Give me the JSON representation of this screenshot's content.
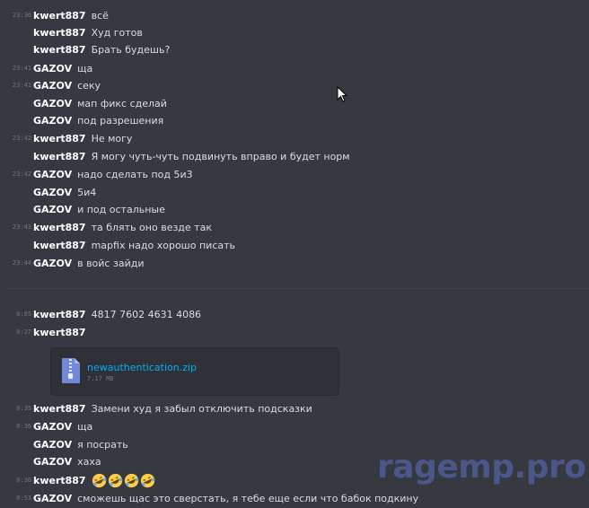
{
  "messages_top": [
    {
      "time": "23:36",
      "author": "kwert887",
      "text": "всё"
    },
    {
      "time": "",
      "author": "kwert887",
      "text": "Худ готов"
    },
    {
      "time": "",
      "author": "kwert887",
      "text": "Брать будешь?"
    },
    {
      "time": "23:41",
      "author": "GAZOV",
      "text": "ща"
    },
    {
      "time": "23:41",
      "author": "GAZOV",
      "text": "секу"
    },
    {
      "time": "",
      "author": "GAZOV",
      "text": "мап фикс сделай"
    },
    {
      "time": "",
      "author": "GAZOV",
      "text": "под разрешения"
    },
    {
      "time": "23:42",
      "author": "kwert887",
      "text": "Не могу"
    },
    {
      "time": "",
      "author": "kwert887",
      "text": "Я могу чуть-чуть подвинуть вправо и будет норм"
    },
    {
      "time": "23:42",
      "author": "GAZOV",
      "text": "надо сделать под 5и3"
    },
    {
      "time": "",
      "author": "GAZOV",
      "text": "5и4"
    },
    {
      "time": "",
      "author": "GAZOV",
      "text": "и под остальные"
    },
    {
      "time": "23:43",
      "author": "kwert887",
      "text": "та блять оно везде так"
    },
    {
      "time": "",
      "author": "kwert887",
      "text": "mapfix надо хорошо писать"
    },
    {
      "time": "23:44",
      "author": "GAZOV",
      "text": "в войс зайди"
    }
  ],
  "messages_bottom": [
    {
      "time": "0:05",
      "author": "kwert887",
      "text": "4817 7602 4631 4086"
    },
    {
      "time": "0:27",
      "author": "kwert887",
      "text": ""
    },
    {
      "time": "0:35",
      "author": "kwert887",
      "text": "Замени худ я забыл отключить подсказки"
    },
    {
      "time": "0:36",
      "author": "GAZOV",
      "text": "ща"
    },
    {
      "time": "",
      "author": "GAZOV",
      "text": "я посрать"
    },
    {
      "time": "",
      "author": "GAZOV",
      "text": "хаха"
    },
    {
      "time": "0:36",
      "author": "kwert887",
      "text": ""
    },
    {
      "time": "0:53",
      "author": "GAZOV",
      "text": "сможешь щас это сверстать, я тебе еще если что бабок подкину"
    }
  ],
  "attachment": {
    "file_name": "newauthentication.zip",
    "file_size": "7.17 MB",
    "icon": "zip-file-icon"
  },
  "reaction_emojis": [
    "rolling-on-floor-laughing-icon",
    "rolling-on-floor-laughing-icon",
    "rolling-on-floor-laughing-icon",
    "rolling-on-floor-laughing-icon"
  ],
  "watermark": "ragemp.pro",
  "colors": {
    "background": "#36393f",
    "link": "#00b0f4",
    "timestamp": "#72767d",
    "author": "#ffffff",
    "text": "#dcddde",
    "watermark": "#4f5d99"
  }
}
